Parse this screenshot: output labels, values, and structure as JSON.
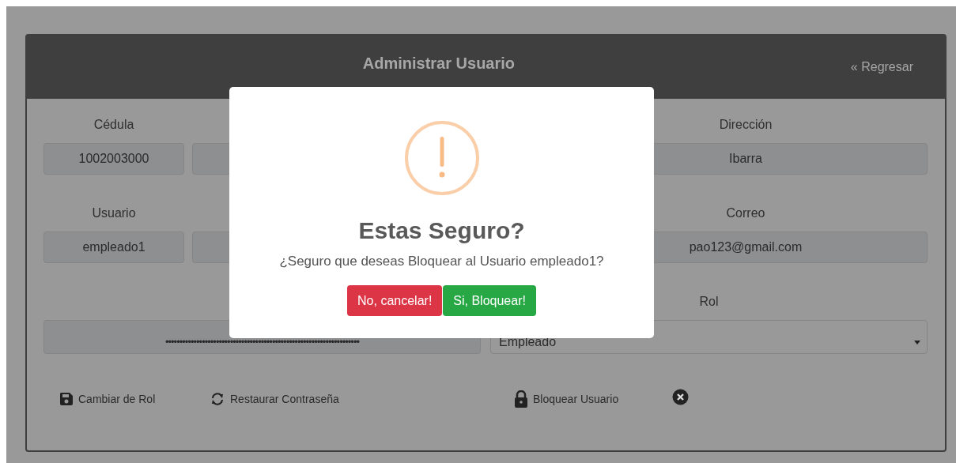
{
  "header": {
    "title": "Administrar Usuario",
    "back_link": "« Regresar"
  },
  "form": {
    "rows": [
      [
        {
          "kind": "text",
          "label": "Cédula",
          "value": "1002003000"
        },
        {
          "kind": "text"
        },
        {
          "kind": "text",
          "label": "Dirección",
          "value": "Ibarra"
        }
      ],
      [
        {
          "kind": "text",
          "label": "Usuario",
          "value": "empleado1"
        },
        {
          "kind": "text"
        },
        {
          "kind": "text",
          "label": "Correo",
          "value": "pao123@gmail.com"
        }
      ],
      [
        {
          "kind": "password",
          "value": "•••••••••••••••••••••••••••••••••••••••••••••••••••••••••••••••••••••"
        },
        {
          "kind": "select",
          "label": "Rol",
          "value": "Empleado"
        }
      ]
    ]
  },
  "actions": [
    {
      "kind": "save",
      "label": "Cambiar de Rol"
    },
    {
      "kind": "refresh",
      "label": "Restaurar Contraseña"
    },
    {
      "kind": "lock",
      "label": "Bloquear Usuario"
    },
    {
      "kind": "close"
    }
  ],
  "dialog": {
    "title": "Estas Seguro?",
    "message": "¿Seguro que deseas Bloquear al Usuario empleado1?",
    "buttons": [
      {
        "kind": "cancel",
        "label": "No, cancelar!"
      },
      {
        "kind": "confirm",
        "label": "Si, Bloquear!"
      }
    ]
  }
}
